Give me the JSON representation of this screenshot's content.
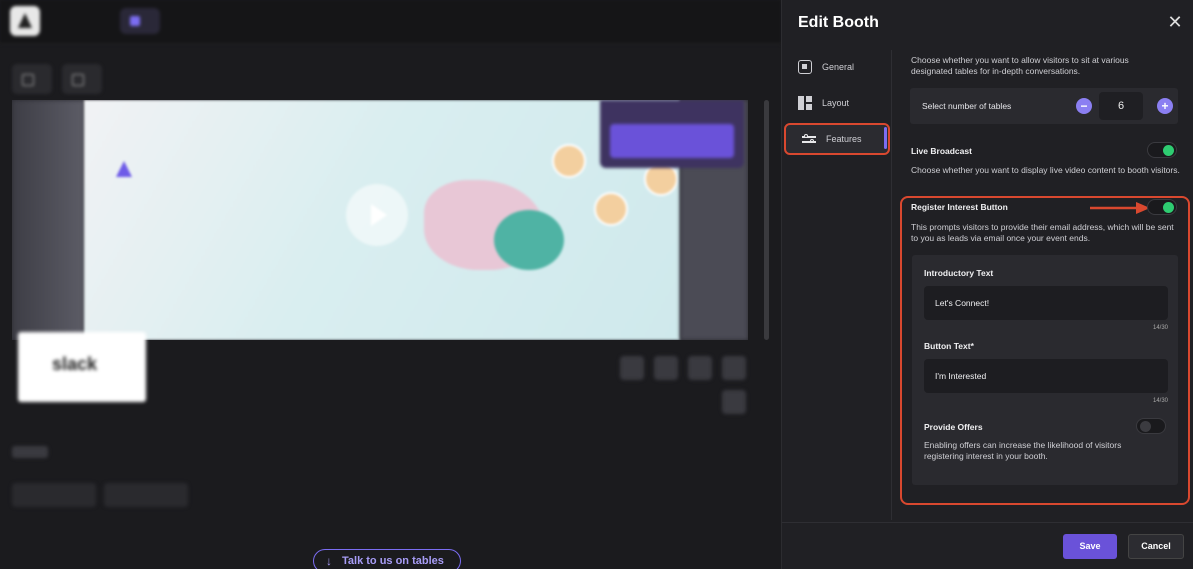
{
  "background_app": {
    "talk_button_label": "Talk to us on tables"
  },
  "panel": {
    "title": "Edit Booth",
    "nav": [
      {
        "label": "General",
        "icon": "general-icon"
      },
      {
        "label": "Layout",
        "icon": "layout-icon"
      },
      {
        "label": "Features",
        "icon": "sliders-icon"
      }
    ],
    "tables_description": "Choose whether you want to allow visitors to sit at various designated tables for in-depth conversations.",
    "tables_label": "Select number of tables",
    "tables_value": "6",
    "live_broadcast": {
      "label": "Live Broadcast",
      "description": "Choose whether you want to display live video content to booth visitors.",
      "enabled": true
    },
    "register_interest": {
      "label": "Register Interest Button",
      "description": "This prompts visitors to provide their email address, which will be sent to you as leads via email once your event ends.",
      "enabled": true,
      "intro_label": "Introductory Text",
      "intro_value": "Let's Connect!",
      "intro_counter": "14/30",
      "button_label": "Button Text*",
      "button_value": "I'm Interested",
      "button_counter": "14/30",
      "offers_label": "Provide Offers",
      "offers_description": "Enabling offers can increase the likelihood of visitors registering interest in your booth.",
      "offers_enabled": false
    },
    "save_label": "Save",
    "cancel_label": "Cancel"
  },
  "colors": {
    "accent": "#6a52d9",
    "toggle_on": "#2ecc71",
    "annotation": "#d9482f"
  }
}
